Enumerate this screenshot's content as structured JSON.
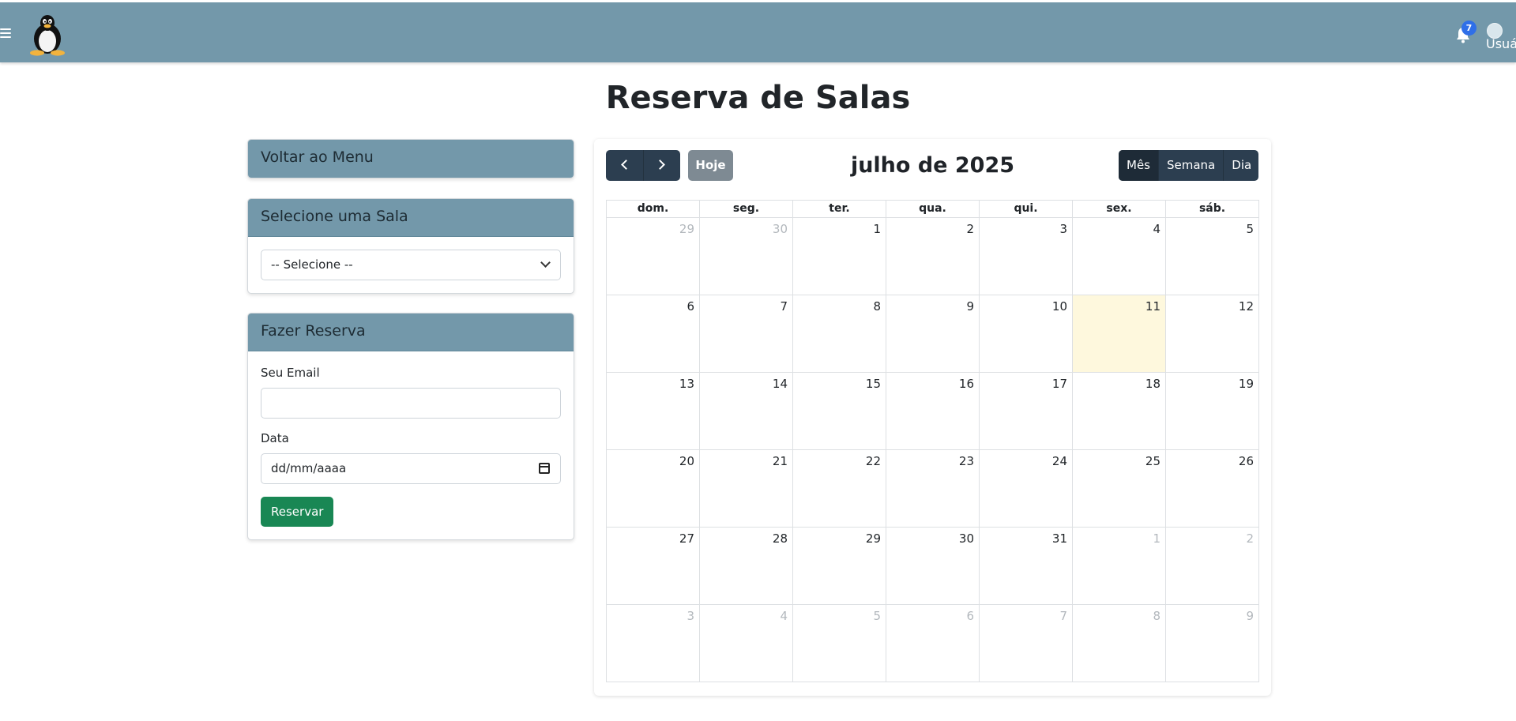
{
  "header": {
    "menu_icon": "hamburger-menu-icon",
    "logo_icon": "linux-penguin-logo",
    "notifications_icon": "bell-icon",
    "notifications_count": "7",
    "user_label": "Usuário"
  },
  "page": {
    "title": "Reserva de Salas"
  },
  "sidebar": {
    "back_label": "Voltar ao Menu",
    "room_card": {
      "title": "Selecione uma Sala",
      "select_value": "-- Selecione --"
    },
    "reserve_card": {
      "title": "Fazer Reserva",
      "email_label": "Seu Email",
      "email_value": "",
      "date_label": "Data",
      "date_placeholder": "dd/mm/aaaa",
      "submit_label": "Reservar"
    }
  },
  "calendar": {
    "prev_icon": "chevron-left-icon",
    "next_icon": "chevron-right-icon",
    "today_label": "Hoje",
    "title": "julho de 2025",
    "views": [
      "Mês",
      "Semana",
      "Dia"
    ],
    "active_view": "Mês",
    "weekdays": [
      "dom.",
      "seg.",
      "ter.",
      "qua.",
      "qui.",
      "sex.",
      "sáb."
    ],
    "today": "11",
    "weeks": [
      [
        {
          "d": "29",
          "o": true
        },
        {
          "d": "30",
          "o": true
        },
        {
          "d": "1"
        },
        {
          "d": "2"
        },
        {
          "d": "3"
        },
        {
          "d": "4"
        },
        {
          "d": "5"
        }
      ],
      [
        {
          "d": "6"
        },
        {
          "d": "7"
        },
        {
          "d": "8"
        },
        {
          "d": "9"
        },
        {
          "d": "10"
        },
        {
          "d": "11",
          "t": true
        },
        {
          "d": "12"
        }
      ],
      [
        {
          "d": "13"
        },
        {
          "d": "14"
        },
        {
          "d": "15"
        },
        {
          "d": "16"
        },
        {
          "d": "17"
        },
        {
          "d": "18"
        },
        {
          "d": "19"
        }
      ],
      [
        {
          "d": "20"
        },
        {
          "d": "21"
        },
        {
          "d": "22"
        },
        {
          "d": "23"
        },
        {
          "d": "24"
        },
        {
          "d": "25"
        },
        {
          "d": "26"
        }
      ],
      [
        {
          "d": "27"
        },
        {
          "d": "28"
        },
        {
          "d": "29"
        },
        {
          "d": "30"
        },
        {
          "d": "31"
        },
        {
          "d": "1",
          "o": true
        },
        {
          "d": "2",
          "o": true
        }
      ],
      [
        {
          "d": "3",
          "o": true
        },
        {
          "d": "4",
          "o": true
        },
        {
          "d": "5",
          "o": true
        },
        {
          "d": "6",
          "o": true
        },
        {
          "d": "7",
          "o": true
        },
        {
          "d": "8",
          "o": true
        },
        {
          "d": "9",
          "o": true
        }
      ]
    ]
  },
  "colors": {
    "header_bg": "#7398aa",
    "primary_dark": "#2c3e50",
    "success": "#198754",
    "today_highlight": "#fef8dd",
    "badge": "#2f6fe8"
  }
}
